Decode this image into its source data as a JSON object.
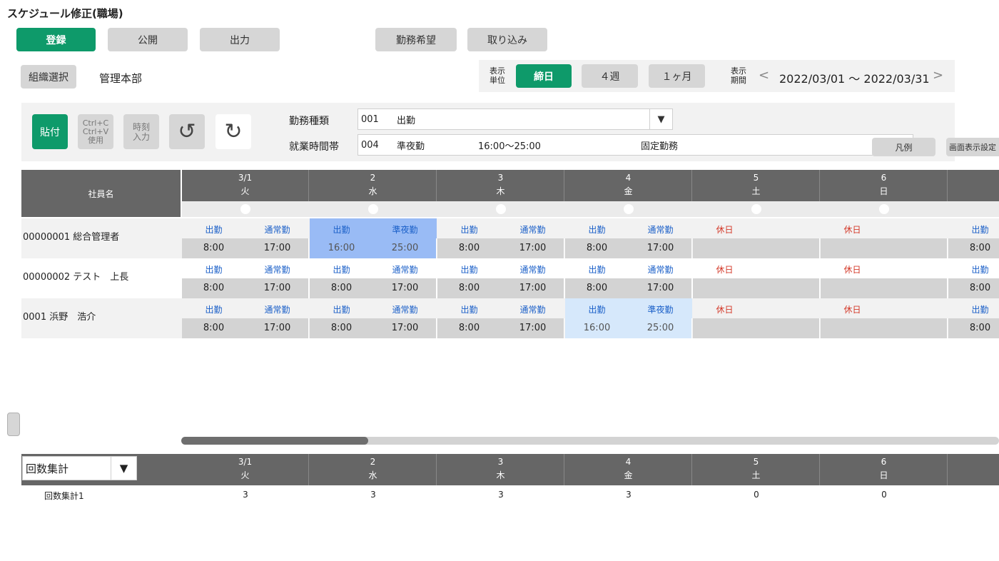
{
  "title": "スケジュール修正(職場)",
  "toolbar": {
    "register": "登録",
    "publish": "公開",
    "output": "出力",
    "requests": "勤務希望",
    "import": "取り込み"
  },
  "org": {
    "select_label": "組織選択",
    "name": "管理本部"
  },
  "display": {
    "unit_label_1": "表示",
    "unit_label_2": "単位",
    "unit_close": "締日",
    "unit_4w": "４週",
    "unit_1m": "１ヶ月",
    "period_label_1": "表示",
    "period_label_2": "期間",
    "prev": "<",
    "next": ">",
    "period": "2022/03/01 〜 2022/03/31"
  },
  "tools": {
    "paste": "貼付",
    "copy_1": "Ctrl+C",
    "copy_2": "Ctrl+V",
    "copy_3": "使用",
    "time_1": "時刻",
    "time_2": "入力",
    "undo": "↺",
    "redo": "↻"
  },
  "work": {
    "type_label": "勤務種類",
    "type_code": "001",
    "type_name": "出勤",
    "band_label": "就業時間帯",
    "band_code": "004",
    "band_name": "準夜勤",
    "band_time": "16:00〜25:00",
    "band_kind": "固定勤務",
    "legend": "凡例",
    "display_settings": "画面表示設定"
  },
  "grid": {
    "name_header": "社員名",
    "days": [
      {
        "date": "3/1",
        "dow": "火"
      },
      {
        "date": "2",
        "dow": "水"
      },
      {
        "date": "3",
        "dow": "木"
      },
      {
        "date": "4",
        "dow": "金"
      },
      {
        "date": "5",
        "dow": "土"
      },
      {
        "date": "6",
        "dow": "日"
      }
    ],
    "employees": [
      {
        "name": "00000001 総合管理者"
      },
      {
        "name": "00000002 テスト　上長"
      },
      {
        "name": "0001 浜野　浩介"
      }
    ],
    "work_label": "出勤",
    "regular": "通常勤",
    "night": "準夜勤",
    "holiday": "休日",
    "t_start": "8:00",
    "t_end": "17:00",
    "n_start": "16:00",
    "n_end": "25:00"
  },
  "summary": {
    "select_value": "回数集計",
    "row_label": "回数集計1",
    "values": [
      "3",
      "3",
      "3",
      "3",
      "0",
      "0"
    ]
  },
  "colors": {
    "accent": "#0e9a6a",
    "header": "#666666",
    "selected": "#99bbf5",
    "highlight": "#d6e8fb"
  }
}
